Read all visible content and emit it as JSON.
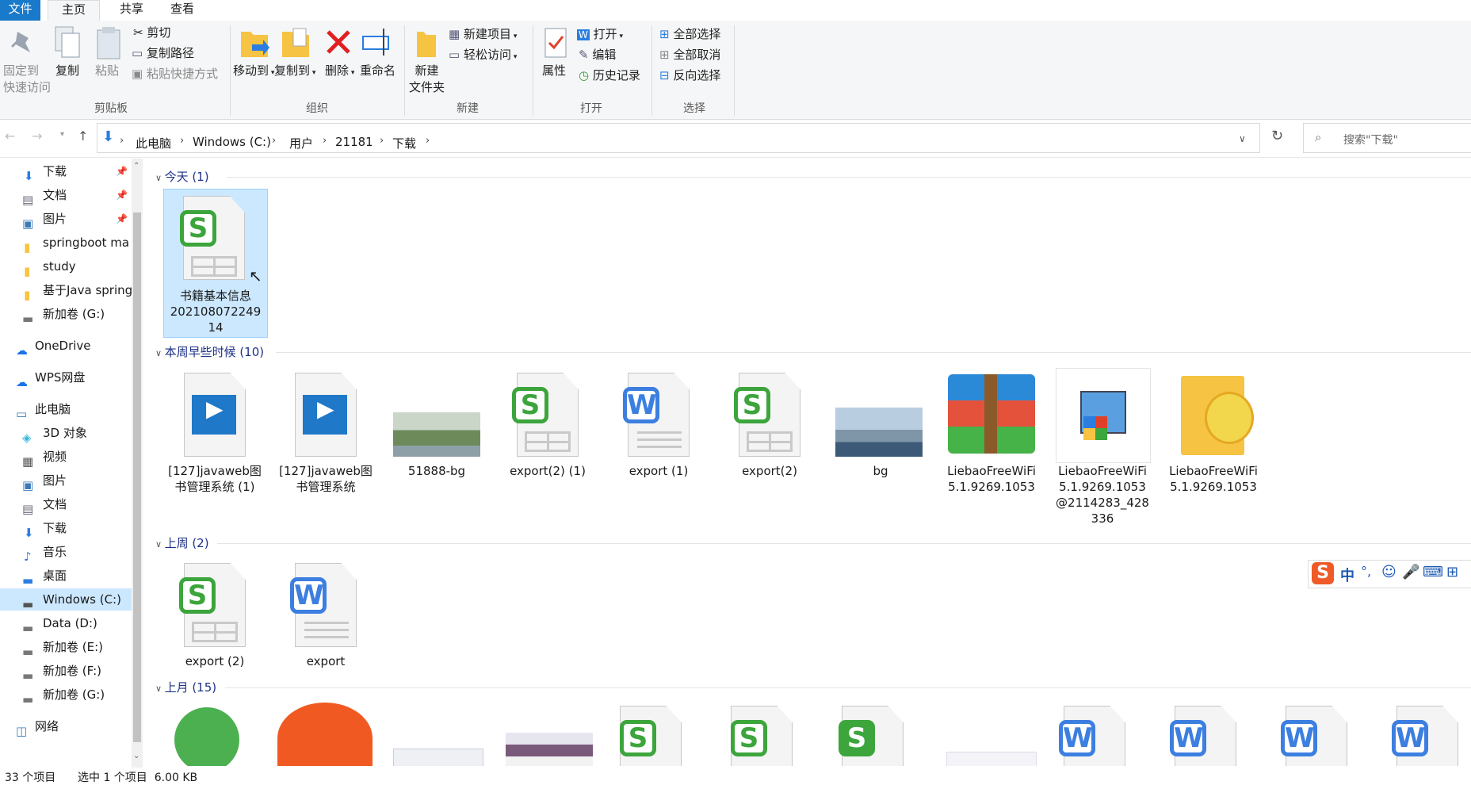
{
  "ribbon_tabs": {
    "file": "文件",
    "home": "主页",
    "share": "共享",
    "view": "查看"
  },
  "clipboard": {
    "pin_line1": "固定到",
    "pin_line2": "快速访问",
    "copy": "复制",
    "paste": "粘贴",
    "cut": "剪切",
    "copy_path": "复制路径",
    "paste_shortcut": "粘贴快捷方式",
    "group": "剪贴板"
  },
  "organize": {
    "move_to": "移动到",
    "copy_to": "复制到",
    "delete": "删除",
    "rename": "重命名",
    "group": "组织"
  },
  "new": {
    "folder_line1": "新建",
    "folder_line2": "文件夹",
    "new_item": "新建项目",
    "easy_access": "轻松访问",
    "group": "新建"
  },
  "open": {
    "properties": "属性",
    "open": "打开",
    "edit": "编辑",
    "history": "历史记录",
    "group": "打开"
  },
  "select": {
    "select_all": "全部选择",
    "select_none": "全部取消",
    "invert": "反向选择",
    "group": "选择"
  },
  "address": {
    "crumbs": [
      "此电脑",
      "Windows (C:)",
      "用户",
      "21181",
      "下载"
    ],
    "search_placeholder": "搜索\"下载\""
  },
  "nav": [
    "下载",
    "文档",
    "图片",
    "springboot ma",
    "study",
    "基于Java spring",
    "新加卷 (G:)",
    "OneDrive",
    "WPS网盘",
    "此电脑",
    "3D 对象",
    "视频",
    "图片",
    "文档",
    "下载",
    "音乐",
    "桌面",
    "Windows (C:)",
    "Data (D:)",
    "新加卷 (E:)",
    "新加卷 (F:)",
    "新加卷 (G:)",
    "网络"
  ],
  "groups": [
    {
      "header": "今天 (1)",
      "items": [
        [
          "书籍基本信息",
          "202108072249",
          "14"
        ]
      ]
    },
    {
      "header": "本周早些时候 (10)",
      "items": [
        [
          "[127]javaweb图",
          "书管理系统 (1)"
        ],
        [
          "[127]javaweb图",
          "书管理系统"
        ],
        [
          "51888-bg"
        ],
        [
          "export(2) (1)"
        ],
        [
          "export (1)"
        ],
        [
          "export(2)"
        ],
        [
          "bg"
        ],
        [
          "LiebaoFreeWiFi",
          "5.1.9269.1053"
        ],
        [
          "LiebaoFreeWiFi",
          "5.1.9269.1053",
          "@2114283_428",
          "336"
        ],
        [
          "LiebaoFreeWiFi",
          "5.1.9269.1053"
        ]
      ]
    },
    {
      "header": "上周 (2)",
      "items": [
        [
          "export (2)"
        ],
        [
          "export"
        ]
      ]
    },
    {
      "header": "上月 (15)",
      "items": []
    }
  ],
  "status": {
    "count": "33 个项目",
    "selection": "选中 1 个项目  6.00 KB"
  },
  "ime": {
    "label": "中"
  },
  "colors": {
    "accent": "#1979ca",
    "selection": "#cce8ff",
    "sheet": "#3ca53c",
    "word": "#3c7fe0"
  }
}
